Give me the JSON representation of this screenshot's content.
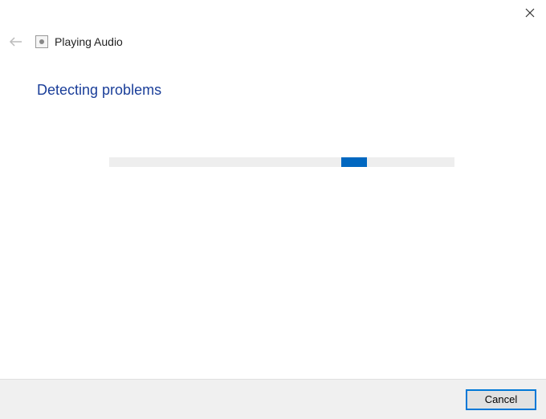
{
  "window": {
    "title": "Playing Audio"
  },
  "main": {
    "heading": "Detecting problems"
  },
  "progress": {
    "position_percent": 67,
    "indicator_width_percent": 7
  },
  "footer": {
    "cancel_label": "Cancel"
  },
  "colors": {
    "accent": "#0067c0",
    "heading": "#1a3e99",
    "button_border": "#0078d7",
    "footer_bg": "#f0f0f0",
    "progress_bg": "#eeeeee"
  }
}
